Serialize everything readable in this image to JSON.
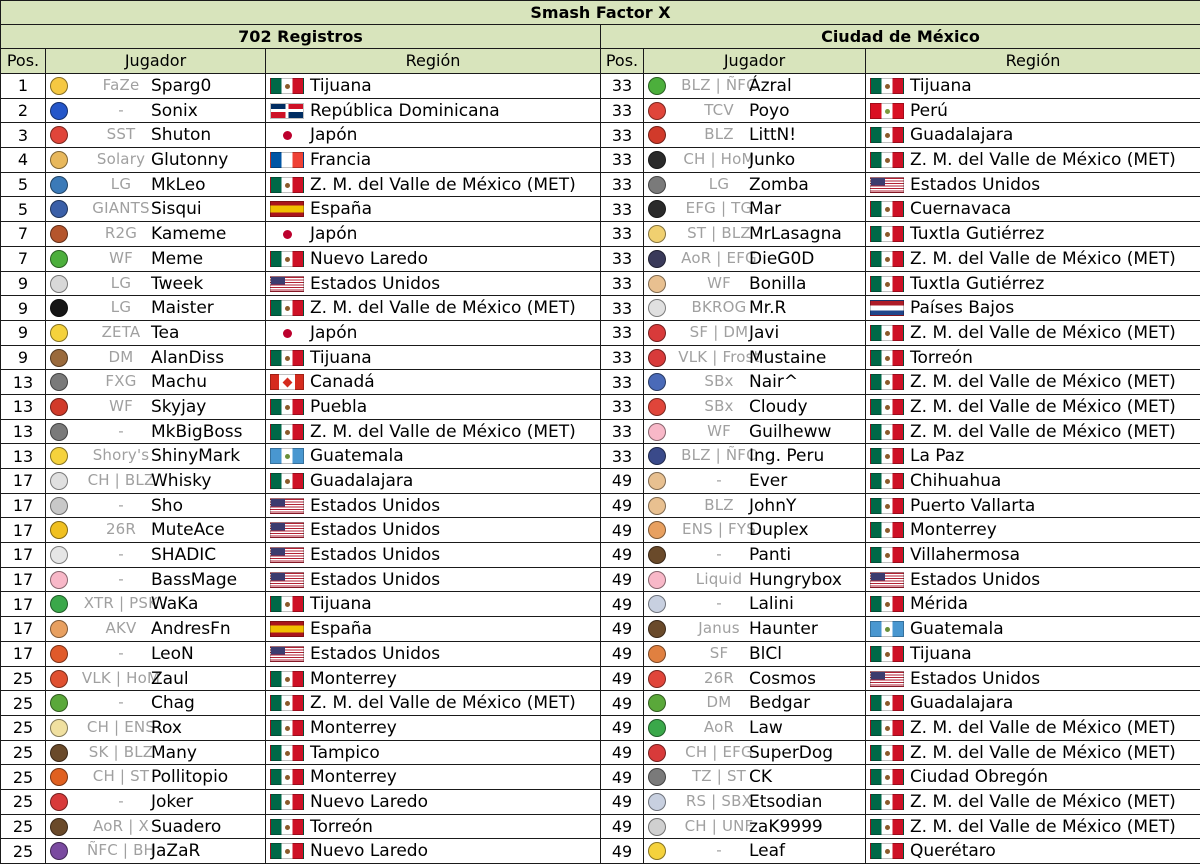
{
  "title": "Smash Factor X",
  "left_caption": "702 Registros",
  "right_caption": "Ciudad de México",
  "columns": {
    "pos": "Pos.",
    "player": "Jugador",
    "region": "Región"
  },
  "flag_colors": {
    "mx": "#006847",
    "us": "#3c3b6e",
    "es": "#f1bf00",
    "jp": "#bc002d"
  },
  "left_rows": [
    {
      "pos": "1",
      "icon": "#f5c842",
      "team": "FaZe",
      "tag": "Sparg0",
      "flag": "mx",
      "region": "Tijuana"
    },
    {
      "pos": "2",
      "icon": "#2456c9",
      "team": "-",
      "tag": "Sonix",
      "flag": "do",
      "region": "República Dominicana"
    },
    {
      "pos": "3",
      "icon": "#e0453a",
      "team": "SST",
      "tag": "Shuton",
      "flag": "jp",
      "region": "Japón"
    },
    {
      "pos": "4",
      "icon": "#e8b85c",
      "team": "Solary",
      "tag": "Glutonny",
      "flag": "fr",
      "region": "Francia"
    },
    {
      "pos": "5",
      "icon": "#3b7ab8",
      "team": "LG",
      "tag": "MkLeo",
      "flag": "mx",
      "region": "Z. M. del Valle de México (MET)"
    },
    {
      "pos": "5",
      "icon": "#3a5fa8",
      "team": "GIANTS",
      "tag": "Sisqui",
      "flag": "es",
      "region": "España"
    },
    {
      "pos": "7",
      "icon": "#b5552c",
      "team": "R2G",
      "tag": "Kameme",
      "flag": "jp",
      "region": "Japón"
    },
    {
      "pos": "7",
      "icon": "#4caf3c",
      "team": "WF",
      "tag": "Meme",
      "flag": "mx",
      "region": "Nuevo Laredo"
    },
    {
      "pos": "9",
      "icon": "#d8d8d8",
      "team": "LG",
      "tag": "Tweek",
      "flag": "us",
      "region": "Estados Unidos"
    },
    {
      "pos": "9",
      "icon": "#151515",
      "team": "LG",
      "tag": "Maister",
      "flag": "mx",
      "region": "Z. M. del Valle de México (MET)"
    },
    {
      "pos": "9",
      "icon": "#f5d23c",
      "team": "ZETA",
      "tag": "Tea",
      "flag": "jp",
      "region": "Japón"
    },
    {
      "pos": "9",
      "icon": "#9a6a3c",
      "team": "DM",
      "tag": "AlanDiss",
      "flag": "mx",
      "region": "Tijuana"
    },
    {
      "pos": "13",
      "icon": "#7a7a7a",
      "team": "FXG",
      "tag": "Machu",
      "flag": "ca",
      "region": "Canadá"
    },
    {
      "pos": "13",
      "icon": "#d13a2a",
      "team": "WF",
      "tag": "Skyjay",
      "flag": "mx",
      "region": "Puebla"
    },
    {
      "pos": "13",
      "icon": "#7a7a7a",
      "team": "-",
      "tag": "MkBigBoss",
      "flag": "mx",
      "region": "Z. M. del Valle de México (MET)"
    },
    {
      "pos": "13",
      "icon": "#f5d23c",
      "team": "Shory's",
      "tag": "ShinyMark",
      "flag": "gt",
      "region": "Guatemala"
    },
    {
      "pos": "17",
      "icon": "#e0e0e0",
      "team": "CH | BLZ",
      "tag": "Whisky",
      "flag": "mx",
      "region": "Guadalajara"
    },
    {
      "pos": "17",
      "icon": "#c8c8c8",
      "team": "-",
      "tag": "Sho",
      "flag": "us",
      "region": "Estados Unidos"
    },
    {
      "pos": "17",
      "icon": "#f0c020",
      "team": "26R",
      "tag": "MuteAce",
      "flag": "us",
      "region": "Estados Unidos"
    },
    {
      "pos": "17",
      "icon": "#e6e6e6",
      "team": "-",
      "tag": "SHADIC",
      "flag": "us",
      "region": "Estados Unidos"
    },
    {
      "pos": "17",
      "icon": "#f8b8c8",
      "team": "-",
      "tag": "BassMage",
      "flag": "us",
      "region": "Estados Unidos"
    },
    {
      "pos": "17",
      "icon": "#3aa84a",
      "team": "XTR | PSK",
      "tag": "WaKa",
      "flag": "mx",
      "region": "Tijuana"
    },
    {
      "pos": "17",
      "icon": "#e8a060",
      "team": "AKV",
      "tag": "AndresFn",
      "flag": "es",
      "region": "España"
    },
    {
      "pos": "17",
      "icon": "#e05a2a",
      "team": "-",
      "tag": "LeoN",
      "flag": "us",
      "region": "Estados Unidos"
    },
    {
      "pos": "25",
      "icon": "#e05030",
      "team": "VLK | HoM",
      "tag": "Zaul",
      "flag": "mx",
      "region": "Monterrey"
    },
    {
      "pos": "25",
      "icon": "#5aa83a",
      "team": "-",
      "tag": "Chag",
      "flag": "mx",
      "region": "Z. M. del Valle de México (MET)"
    },
    {
      "pos": "25",
      "icon": "#f0e0a0",
      "team": "CH | ENS",
      "tag": "Rox",
      "flag": "mx",
      "region": "Monterrey"
    },
    {
      "pos": "25",
      "icon": "#6a4a2a",
      "team": "SK | BLZ",
      "tag": "Many",
      "flag": "mx",
      "region": "Tampico"
    },
    {
      "pos": "25",
      "icon": "#e06020",
      "team": "CH | ST",
      "tag": "Pollitopio",
      "flag": "mx",
      "region": "Monterrey"
    },
    {
      "pos": "25",
      "icon": "#d83a3a",
      "team": "-",
      "tag": "Joker",
      "flag": "mx",
      "region": "Nuevo Laredo"
    },
    {
      "pos": "25",
      "icon": "#6a4a2a",
      "team": "AoR | X",
      "tag": "Suadero",
      "flag": "mx",
      "region": "Torreón"
    },
    {
      "pos": "25",
      "icon": "#7a4aa0",
      "team": "ÑFC | BH",
      "tag": "JaZaR",
      "flag": "mx",
      "region": "Nuevo Laredo"
    }
  ],
  "right_rows": [
    {
      "pos": "33",
      "icon": "#4caf3c",
      "team": "BLZ | ÑFC",
      "tag": "Ázral",
      "flag": "mx",
      "region": "Tijuana"
    },
    {
      "pos": "33",
      "icon": "#e0453a",
      "team": "TCV",
      "tag": "Poyo",
      "flag": "pe",
      "region": "Perú"
    },
    {
      "pos": "33",
      "icon": "#d13a2a",
      "team": "BLZ",
      "tag": "LittN!",
      "flag": "mx",
      "region": "Guadalajara"
    },
    {
      "pos": "33",
      "icon": "#2a2a2a",
      "team": "CH | HoM",
      "tag": "Junko",
      "flag": "mx",
      "region": "Z. M. del Valle de México (MET)"
    },
    {
      "pos": "33",
      "icon": "#7a7a7a",
      "team": "LG",
      "tag": "Zomba",
      "flag": "us",
      "region": "Estados Unidos"
    },
    {
      "pos": "33",
      "icon": "#2a2a2a",
      "team": "EFG | TG",
      "tag": "Mar",
      "flag": "mx",
      "region": "Cuernavaca"
    },
    {
      "pos": "33",
      "icon": "#f0d070",
      "team": "ST | BLZ",
      "tag": "MrLasagna",
      "flag": "mx",
      "region": "Tuxtla Gutiérrez"
    },
    {
      "pos": "33",
      "icon": "#3a3a5a",
      "team": "AoR | EFG",
      "tag": "DieG0D",
      "flag": "mx",
      "region": "Z. M. del Valle de México (MET)"
    },
    {
      "pos": "33",
      "icon": "#e8c090",
      "team": "WF",
      "tag": "Bonilla",
      "flag": "mx",
      "region": "Tuxtla Gutiérrez"
    },
    {
      "pos": "33",
      "icon": "#e0e0e0",
      "team": "BKROG",
      "tag": "Mr.R",
      "flag": "nl",
      "region": "Países Bajos"
    },
    {
      "pos": "33",
      "icon": "#d83a3a",
      "team": "SF | DM",
      "tag": "Javi",
      "flag": "mx",
      "region": "Z. M. del Valle de México (MET)"
    },
    {
      "pos": "33",
      "icon": "#d83a3a",
      "team": "VLK | Frost",
      "tag": "Mustaine",
      "flag": "mx",
      "region": "Torreón"
    },
    {
      "pos": "33",
      "icon": "#4a6ab8",
      "team": "SBx",
      "tag": "Nair^",
      "flag": "mx",
      "region": "Z. M. del Valle de México (MET)"
    },
    {
      "pos": "33",
      "icon": "#e0453a",
      "team": "SBx",
      "tag": "Cloudy",
      "flag": "mx",
      "region": "Z. M. del Valle de México (MET)"
    },
    {
      "pos": "33",
      "icon": "#f8b8c8",
      "team": "WF",
      "tag": "Guilheww",
      "flag": "mx",
      "region": "Z. M. del Valle de México (MET)"
    },
    {
      "pos": "33",
      "icon": "#3a4a8a",
      "team": "BLZ | ÑFC",
      "tag": "Ing. Peru",
      "flag": "mx",
      "region": "La Paz"
    },
    {
      "pos": "49",
      "icon": "#e8c090",
      "team": "-",
      "tag": "Ever",
      "flag": "mx",
      "region": "Chihuahua"
    },
    {
      "pos": "49",
      "icon": "#e8c090",
      "team": "BLZ",
      "tag": "JohnY",
      "flag": "mx",
      "region": "Puerto Vallarta"
    },
    {
      "pos": "49",
      "icon": "#e8a060",
      "team": "ENS | FYS",
      "tag": "Duplex",
      "flag": "mx",
      "region": "Monterrey"
    },
    {
      "pos": "49",
      "icon": "#6a4a2a",
      "team": "-",
      "tag": "Panti",
      "flag": "mx",
      "region": "Villahermosa"
    },
    {
      "pos": "49",
      "icon": "#f8b8c8",
      "team": "Liquid",
      "tag": "Hungrybox",
      "flag": "us",
      "region": "Estados Unidos"
    },
    {
      "pos": "49",
      "icon": "#c8d0e0",
      "team": "-",
      "tag": "Lalini",
      "flag": "mx",
      "region": "Mérida"
    },
    {
      "pos": "49",
      "icon": "#6a4a2a",
      "team": "Janus",
      "tag": "Haunter",
      "flag": "gt",
      "region": "Guatemala"
    },
    {
      "pos": "49",
      "icon": "#e08040",
      "team": "SF",
      "tag": "BlCl",
      "flag": "mx",
      "region": "Tijuana"
    },
    {
      "pos": "49",
      "icon": "#e0453a",
      "team": "26R",
      "tag": "Cosmos",
      "flag": "us",
      "region": "Estados Unidos"
    },
    {
      "pos": "49",
      "icon": "#5aa83a",
      "team": "DM",
      "tag": "Bedgar",
      "flag": "mx",
      "region": "Guadalajara"
    },
    {
      "pos": "49",
      "icon": "#3aa84a",
      "team": "AoR",
      "tag": "Law",
      "flag": "mx",
      "region": "Z. M. del Valle de México (MET)"
    },
    {
      "pos": "49",
      "icon": "#d83a3a",
      "team": "CH | EFG",
      "tag": "SuperDog",
      "flag": "mx",
      "region": "Z. M. del Valle de México (MET)"
    },
    {
      "pos": "49",
      "icon": "#7a7a7a",
      "team": "TZ | ST",
      "tag": "CK",
      "flag": "mx",
      "region": "Ciudad Obregón"
    },
    {
      "pos": "49",
      "icon": "#c8d0e0",
      "team": "RS | SBX",
      "tag": "Etsodian",
      "flag": "mx",
      "region": "Z. M. del Valle de México (MET)"
    },
    {
      "pos": "49",
      "icon": "#d0d0d0",
      "team": "CH | UNF",
      "tag": "zaK9999",
      "flag": "mx",
      "region": "Z. M. del Valle de México (MET)"
    },
    {
      "pos": "49",
      "icon": "#f5d23c",
      "team": "-",
      "tag": "Leaf",
      "flag": "mx",
      "region": "Querétaro"
    }
  ]
}
